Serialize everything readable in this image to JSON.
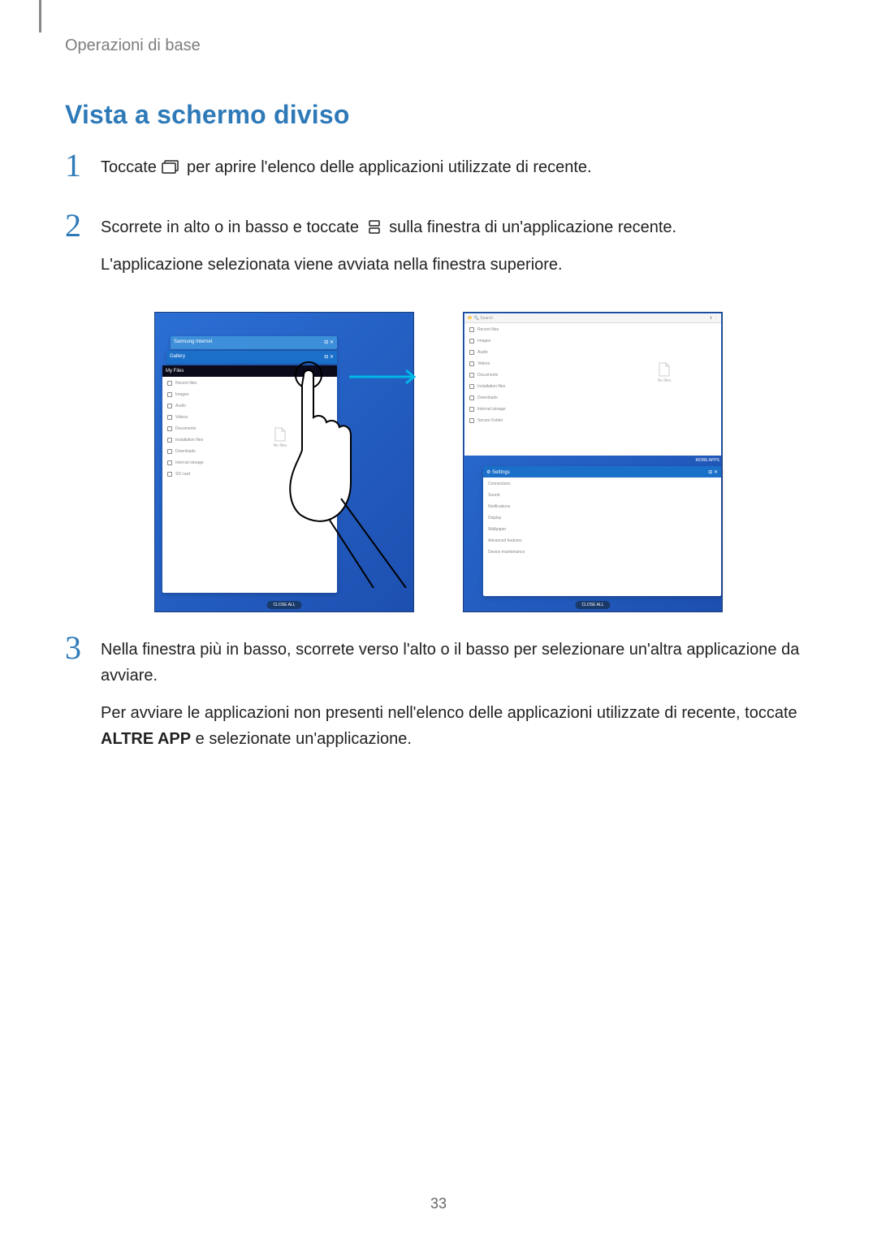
{
  "breadcrumb": "Operazioni di base",
  "title": "Vista a schermo diviso",
  "steps": [
    {
      "num": "1",
      "parts": [
        "Toccate ",
        "{recent-icon}",
        " per aprire l'elenco delle applicazioni utilizzate di recente."
      ]
    },
    {
      "num": "2",
      "parts": [
        "Scorrete in alto o in basso e toccate ",
        "{split-icon}",
        " sulla finestra di un'applicazione recente."
      ],
      "followup": "L'applicazione selezionata viene avviata nella finestra superiore."
    },
    {
      "num": "3",
      "parts": [
        "Nella finestra più in basso, scorrete verso l'alto o il basso per selezionare un'altra applicazione da avviare."
      ],
      "followup_parts": [
        "Per avviare le applicazioni non presenti nell'elenco delle applicazioni utilizzate di recente, toccate ",
        "{bold:ALTRE APP}",
        " e selezionate un'applicazione."
      ]
    }
  ],
  "illustration": {
    "left_screen": {
      "card_labels": [
        "Samsung Internet",
        "Gallery",
        "My Files"
      ],
      "file_rows": [
        "Recent files",
        "Images",
        "Audio",
        "Videos",
        "Documents",
        "Installation files",
        "Downloads",
        "Internal storage",
        "SD card"
      ],
      "close_all": "CLOSE ALL",
      "placeholder": "No files"
    },
    "right_screen": {
      "top_panel": {
        "search": "Search",
        "rows": [
          "Recent files",
          "Images",
          "Audio",
          "Videos",
          "Documents",
          "Installation files",
          "Downloads",
          "Internal storage",
          "Secure Folder"
        ],
        "placeholder": "No files"
      },
      "more_apps": "MORE APPS",
      "bottom_panel": {
        "header": "Settings",
        "rows": [
          "Connections",
          "Sound",
          "Notifications",
          "Display",
          "Wallpaper",
          "Advanced features",
          "Device maintenance"
        ]
      },
      "close_all": "CLOSE ALL"
    }
  },
  "page_number": "33"
}
